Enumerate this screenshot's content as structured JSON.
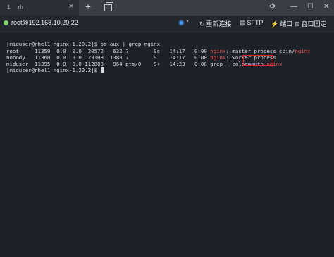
{
  "tab": {
    "number": "1",
    "title": "rh"
  },
  "toolbar": {
    "host": "root@192.168.10.20:22",
    "reconnect": "重新连接",
    "sftp": "SFTP",
    "port": "端口",
    "pin_window": "窗口固定"
  },
  "terminal": {
    "line1": {
      "prompt": "[miduser@rhel1 nginx-1.20.2]$ ",
      "cmd": "ps aux | grep nginx"
    },
    "line2": {
      "pre": "root     11359  0.0  0.0  20572   632 ?        Ss   14:17   0:00 ",
      "hl": "nginx",
      "mid": ": master process sbin/",
      "hl2": "nginx"
    },
    "line3": {
      "pre": "nobody   11360  0.0  0.0  23108  1388 ?        S    14:17   0:00 ",
      "hl": "nginx",
      "post": ": worker process"
    },
    "line4": {
      "pre": "miduser  11395  0.0  0.0 112808   964 pts/0    S+   14:23   0:00 grep --color=auto ",
      "hl": "nginx"
    },
    "line5": {
      "prompt": "[miduser@rhel1 nginx-1.20.2]$ "
    }
  }
}
